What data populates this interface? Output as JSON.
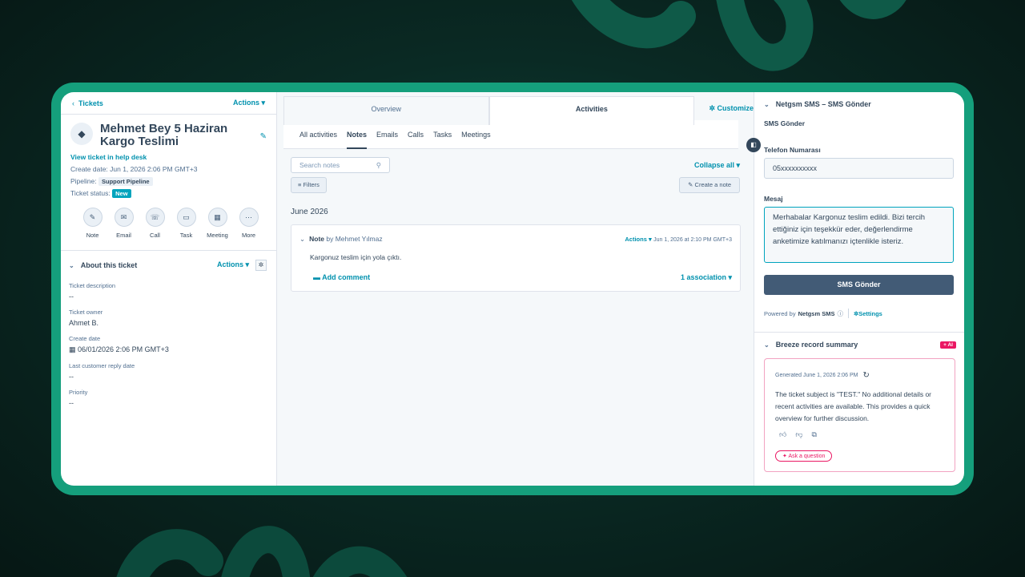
{
  "left": {
    "back_label": "Tickets",
    "actions_label": "Actions ▾",
    "ticket_title": "Mehmet Bey 5 Haziran Kargo Teslimi",
    "view_link": "View ticket in help desk",
    "create_date": "Create date: Jun 1, 2026 2:06 PM GMT+3",
    "pipeline_label": "Pipeline:",
    "pipeline_value": "Support Pipeline",
    "status_label": "Ticket status:",
    "status_value": "New",
    "quick_actions": [
      {
        "label": "Note",
        "icon": "✎"
      },
      {
        "label": "Email",
        "icon": "✉"
      },
      {
        "label": "Call",
        "icon": "☏"
      },
      {
        "label": "Task",
        "icon": "▭"
      },
      {
        "label": "Meeting",
        "icon": "▦"
      },
      {
        "label": "More",
        "icon": "⋯"
      }
    ],
    "about_title": "About this ticket",
    "about_actions": "Actions ▾",
    "properties": [
      {
        "label": "Ticket description",
        "value": "--"
      },
      {
        "label": "Ticket owner",
        "value": "Ahmet B."
      },
      {
        "label": "Create date",
        "value": "06/01/2026 2:06 PM GMT+3"
      },
      {
        "label": "Last customer reply date",
        "value": "--"
      },
      {
        "label": "Priority",
        "value": "--"
      }
    ]
  },
  "middle": {
    "tabs": [
      "Overview",
      "Activities"
    ],
    "customize": "Customize",
    "subtabs": [
      "All activities",
      "Notes",
      "Emails",
      "Calls",
      "Tasks",
      "Meetings"
    ],
    "search_placeholder": "Search notes",
    "collapse_all": "Collapse all ▾",
    "filters": "Filters",
    "create_note": "Create a note",
    "month": "June 2026",
    "note": {
      "type": "Note",
      "author": "by Mehmet Yılmaz",
      "actions": "Actions ▾",
      "timestamp": "Jun 1, 2026 at 2:10 PM GMT+3",
      "body": "Kargonuz teslim için yola çıktı.",
      "add_comment": "Add comment",
      "association": "1 association ▾"
    }
  },
  "right": {
    "sms_section_title": "Netgsm SMS – SMS Gönder",
    "sms_form_title": "SMS Gönder",
    "phone_label": "Telefon Numarası",
    "phone_value": "05xxxxxxxxxx",
    "message_label": "Mesaj",
    "message_value": "Merhabalar Kargonuz teslim edildi. Bizi tercih ettiğiniz için teşekkür eder, değerlendirme anketimize katılmanızı içtenlikle isteriz.",
    "send_button": "SMS Gönder",
    "powered_by": "Powered by",
    "powered_brand": "Netgsm SMS",
    "settings": "Settings",
    "breeze_title": "Breeze record summary",
    "ai_badge": "+ AI",
    "generated": "Generated June 1, 2026 2:06 PM",
    "summary": "The ticket subject is \"TEST.\" No additional details or recent activities are available. This provides a quick overview for further discussion.",
    "ask_question": "Ask a question"
  },
  "colors": {
    "accent": "#0091ae",
    "frame": "#159f7c",
    "ai_pink": "#ea1763",
    "button_dark": "#425b76"
  }
}
